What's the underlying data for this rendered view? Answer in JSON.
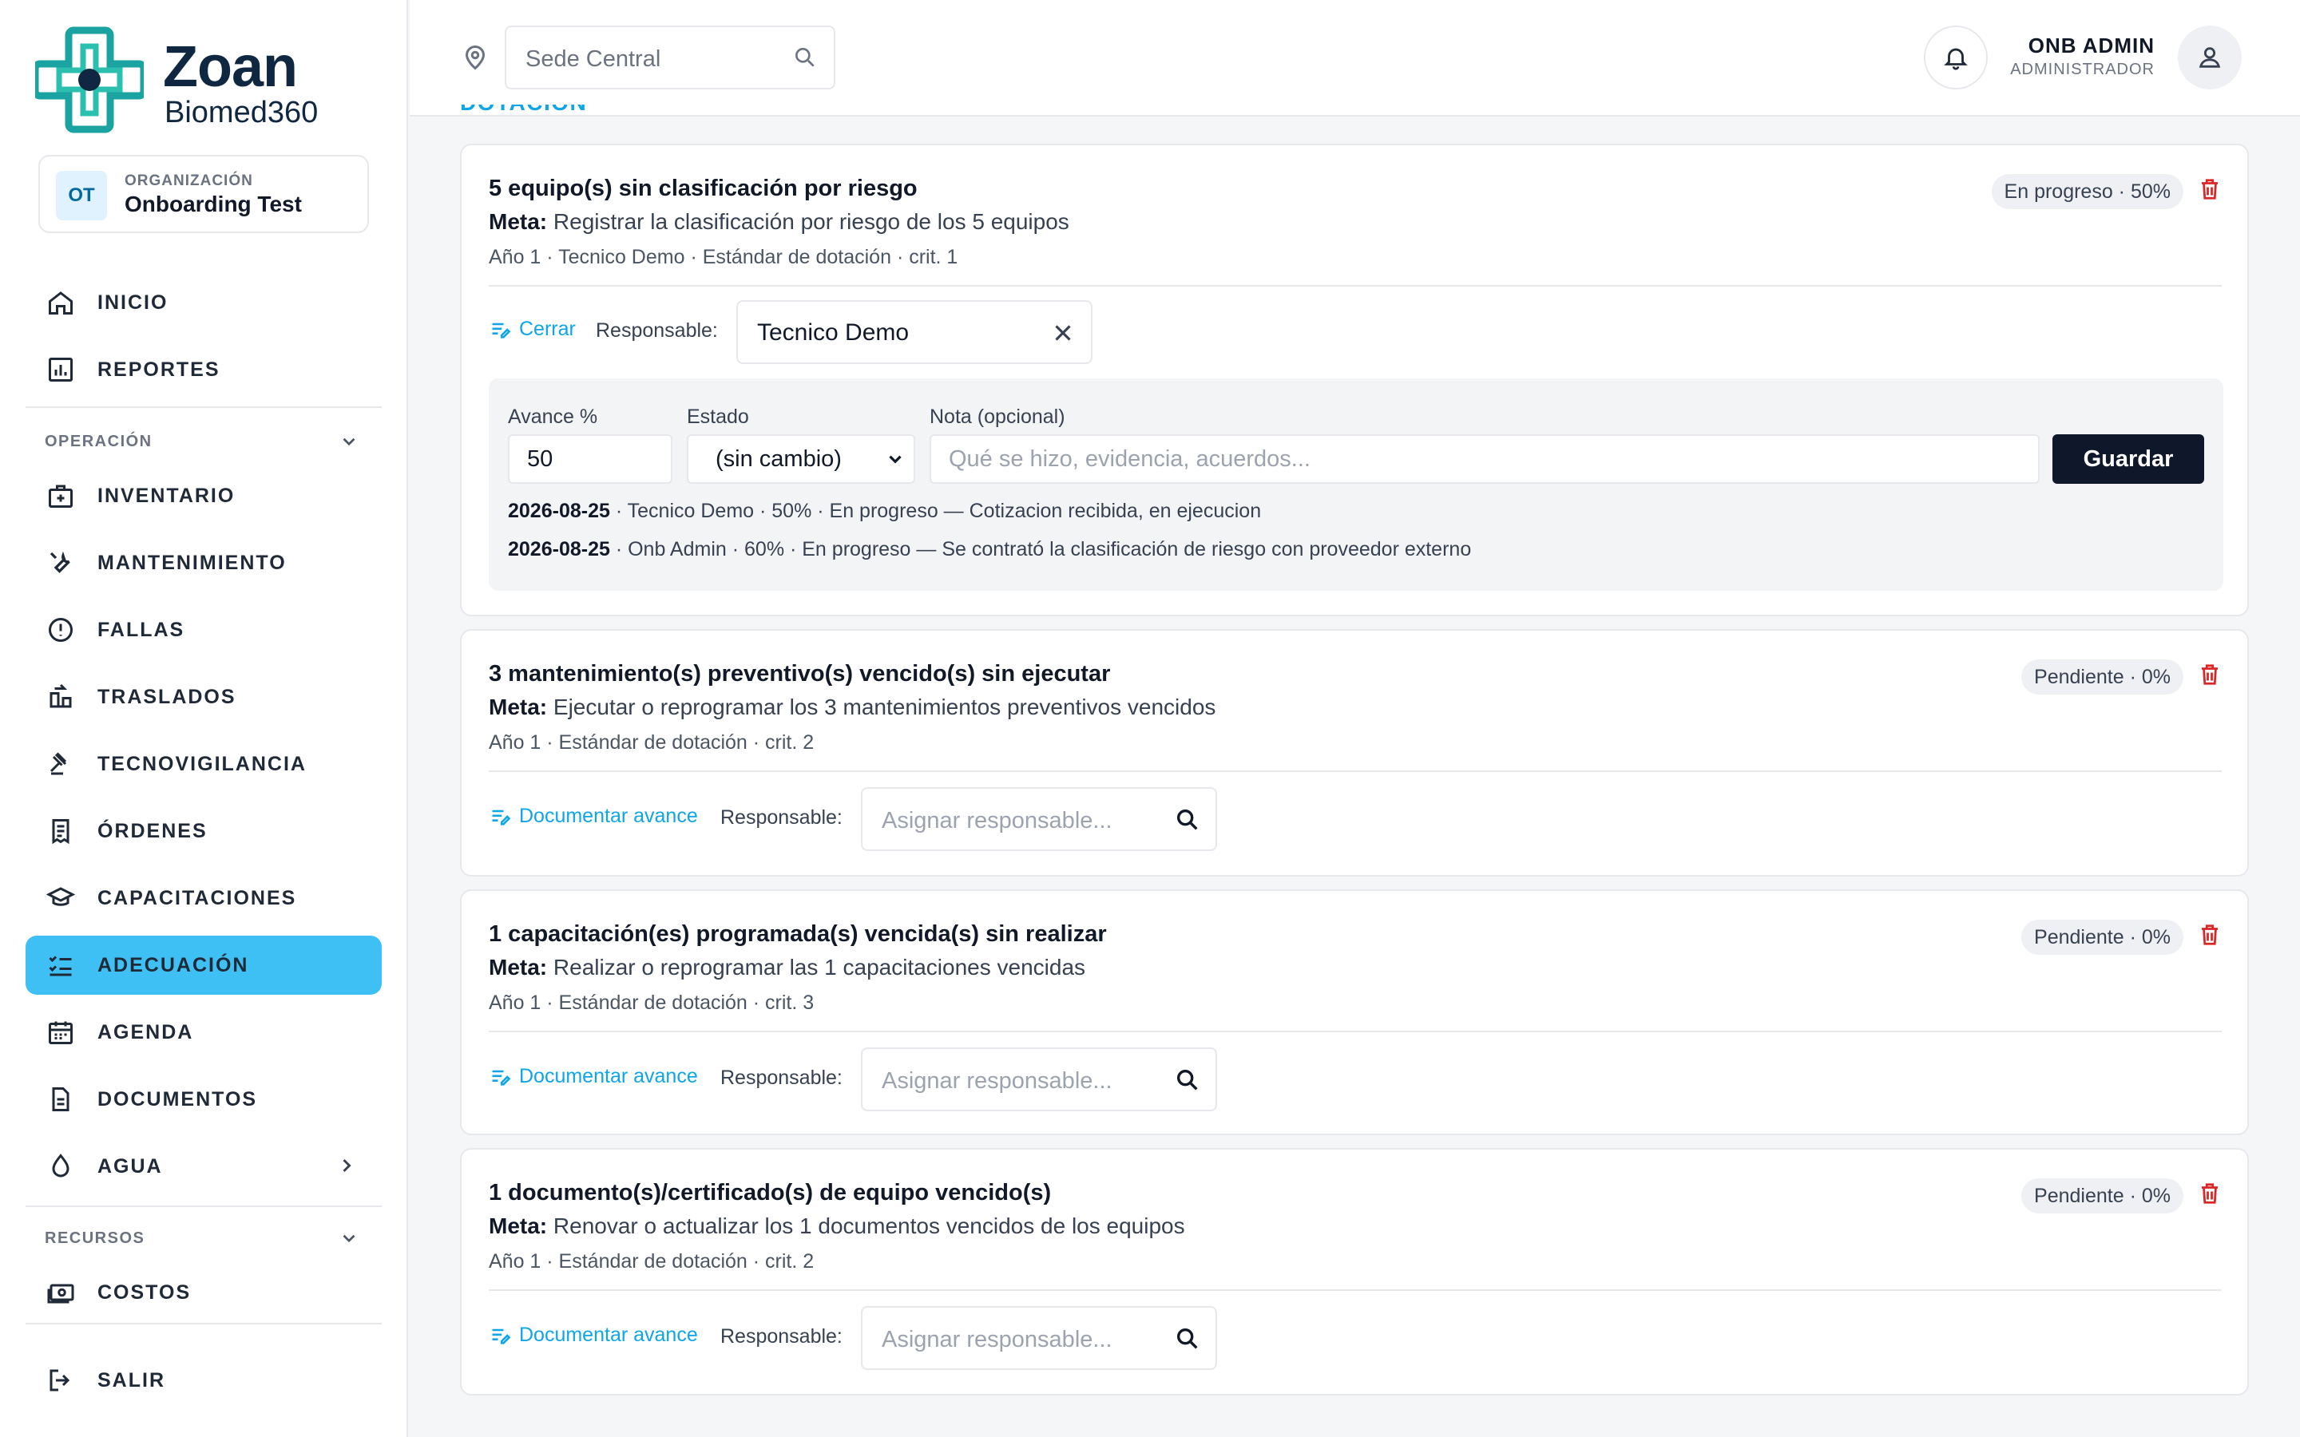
{
  "brand": {
    "name": "Zoan",
    "sub": "Biomed360",
    "accent": "#3ec0f4",
    "logo_color": "#1aa3a0"
  },
  "org": {
    "badge": "OT",
    "label": "ORGANIZACIÓN",
    "name": "Onboarding Test"
  },
  "nav": {
    "inicio": "INICIO",
    "reportes": "REPORTES",
    "section_operacion": "OPERACIÓN",
    "inventario": "INVENTARIO",
    "mantenimiento": "MANTENIMIENTO",
    "fallas": "FALLAS",
    "traslados": "TRASLADOS",
    "tecnovigilancia": "TECNOVIGILANCIA",
    "ordenes": "ÓRDENES",
    "capacitaciones": "CAPACITACIONES",
    "adecuacion": "ADECUACIÓN",
    "agenda": "AGENDA",
    "documentos": "DOCUMENTOS",
    "agua": "AGUA",
    "section_recursos": "RECURSOS",
    "costos": "COSTOS",
    "salir": "SALIR"
  },
  "header": {
    "site_placeholder": "Sede Central",
    "user_name": "ONB ADMIN",
    "user_role": "ADMINISTRADOR"
  },
  "section_title": "DOTACIÓN",
  "cards": [
    {
      "title": "5 equipo(s) sin clasificación por riesgo",
      "meta_label": "Meta:",
      "meta": "Registrar la clasificación por riesgo de los 5 equipos",
      "sub": "Año 1 · Tecnico Demo · Estándar de dotación · crit. 1",
      "status": "En progreso · 50%",
      "link": "Cerrar",
      "resp_label": "Responsable:",
      "resp_value": "Tecnico Demo",
      "form": {
        "avance_label": "Avance %",
        "avance_value": "50",
        "estado_label": "Estado",
        "estado_value": "(sin cambio)",
        "nota_label": "Nota (opcional)",
        "nota_placeholder": "Qué se hizo, evidencia, acuerdos...",
        "save": "Guardar"
      },
      "history": [
        {
          "date": "2026-08-25",
          "text": " · Tecnico Demo · 50% · En progreso — Cotizacion recibida, en ejecucion"
        },
        {
          "date": "2026-08-25",
          "text": " · Onb Admin · 60% · En progreso — Se contrató la clasificación de riesgo con proveedor externo"
        }
      ]
    },
    {
      "title": "3 mantenimiento(s) preventivo(s) vencido(s) sin ejecutar",
      "meta_label": "Meta:",
      "meta": "Ejecutar o reprogramar los 3 mantenimientos preventivos vencidos",
      "sub": "Año 1 · Estándar de dotación · crit. 2",
      "status": "Pendiente · 0%",
      "link": "Documentar avance",
      "resp_label": "Responsable:",
      "resp_placeholder": "Asignar responsable..."
    },
    {
      "title": "1 capacitación(es) programada(s) vencida(s) sin realizar",
      "meta_label": "Meta:",
      "meta": "Realizar o reprogramar las 1 capacitaciones vencidas",
      "sub": "Año 1 · Estándar de dotación · crit. 3",
      "status": "Pendiente · 0%",
      "link": "Documentar avance",
      "resp_label": "Responsable:",
      "resp_placeholder": "Asignar responsable..."
    },
    {
      "title": "1 documento(s)/certificado(s) de equipo vencido(s)",
      "meta_label": "Meta:",
      "meta": "Renovar o actualizar los 1 documentos vencidos de los equipos",
      "sub": "Año 1 · Estándar de dotación · crit. 2",
      "status": "Pendiente · 0%",
      "link": "Documentar avance",
      "resp_label": "Responsable:",
      "resp_placeholder": "Asignar responsable..."
    }
  ]
}
